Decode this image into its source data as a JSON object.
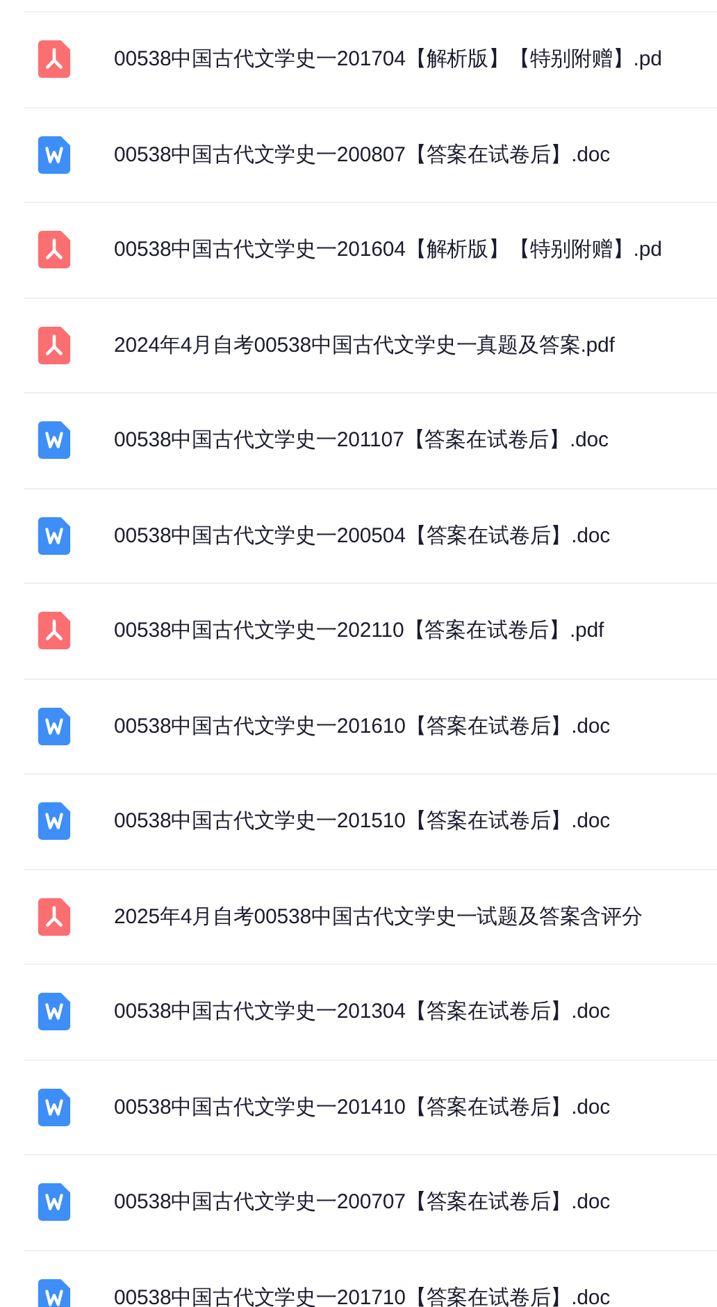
{
  "files": [
    {
      "kind": "pdf",
      "name": "00538中国古代文学史一201704【解析版】【特别附赠】.pd"
    },
    {
      "kind": "doc",
      "name": "00538中国古代文学史一200807【答案在试卷后】.doc"
    },
    {
      "kind": "pdf",
      "name": "00538中国古代文学史一201604【解析版】【特别附赠】.pd"
    },
    {
      "kind": "pdf",
      "name": "2024年4月自考00538中国古代文学史一真题及答案.pdf"
    },
    {
      "kind": "doc",
      "name": "00538中国古代文学史一201107【答案在试卷后】.doc"
    },
    {
      "kind": "doc",
      "name": "00538中国古代文学史一200504【答案在试卷后】.doc"
    },
    {
      "kind": "pdf",
      "name": "00538中国古代文学史一202110【答案在试卷后】.pdf"
    },
    {
      "kind": "doc",
      "name": "00538中国古代文学史一201610【答案在试卷后】.doc"
    },
    {
      "kind": "doc",
      "name": "00538中国古代文学史一201510【答案在试卷后】.doc"
    },
    {
      "kind": "pdf",
      "name": "2025年4月自考00538中国古代文学史一试题及答案含评分"
    },
    {
      "kind": "doc",
      "name": "00538中国古代文学史一201304【答案在试卷后】.doc"
    },
    {
      "kind": "doc",
      "name": "00538中国古代文学史一201410【答案在试卷后】.doc"
    },
    {
      "kind": "doc",
      "name": "00538中国古代文学史一200707【答案在试卷后】.doc"
    },
    {
      "kind": "doc",
      "name": "00538中国古代文学史一201710【答案在试卷后】.doc"
    }
  ]
}
